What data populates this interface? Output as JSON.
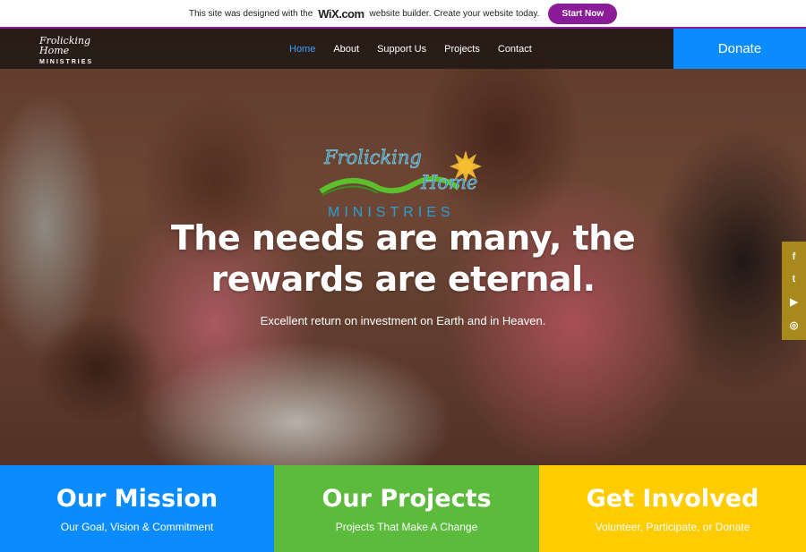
{
  "wix_banner": {
    "text_before": "This site was designed with the",
    "logo": "WiX.com",
    "text_after": "website builder. Create your website today.",
    "button": "Start Now",
    "accent": "#8a1c9a"
  },
  "header": {
    "logo_script": "Frolicking Home",
    "logo_sub": "MINISTRIES",
    "nav": [
      {
        "label": "Home",
        "active": true
      },
      {
        "label": "About",
        "active": false
      },
      {
        "label": "Support Us",
        "active": false
      },
      {
        "label": "Projects",
        "active": false
      },
      {
        "label": "Contact",
        "active": false
      }
    ],
    "donate": "Donate",
    "donate_color": "#0a8cff"
  },
  "hero": {
    "logo_word1": "Frolicking",
    "logo_word2": "Home",
    "logo_sub": "MINISTRIES",
    "headline": "The needs are many, the rewards are eternal.",
    "subtitle": "Excellent return on investment on Earth and in Heaven."
  },
  "social": [
    {
      "icon": "facebook-icon",
      "glyph": "f"
    },
    {
      "icon": "twitter-icon",
      "glyph": "t"
    },
    {
      "icon": "youtube-icon",
      "glyph": "▶"
    },
    {
      "icon": "instagram-icon",
      "glyph": "◎"
    }
  ],
  "cards": [
    {
      "title": "Our Mission",
      "subtitle": "Our Goal, Vision & Commitment",
      "color": "#0a8cff"
    },
    {
      "title": "Our Projects",
      "subtitle": "Projects That Make A Change",
      "color": "#5cba3c"
    },
    {
      "title": "Get Involved",
      "subtitle": "Volunteer, Participate, or Donate",
      "color": "#ffcc00"
    }
  ]
}
